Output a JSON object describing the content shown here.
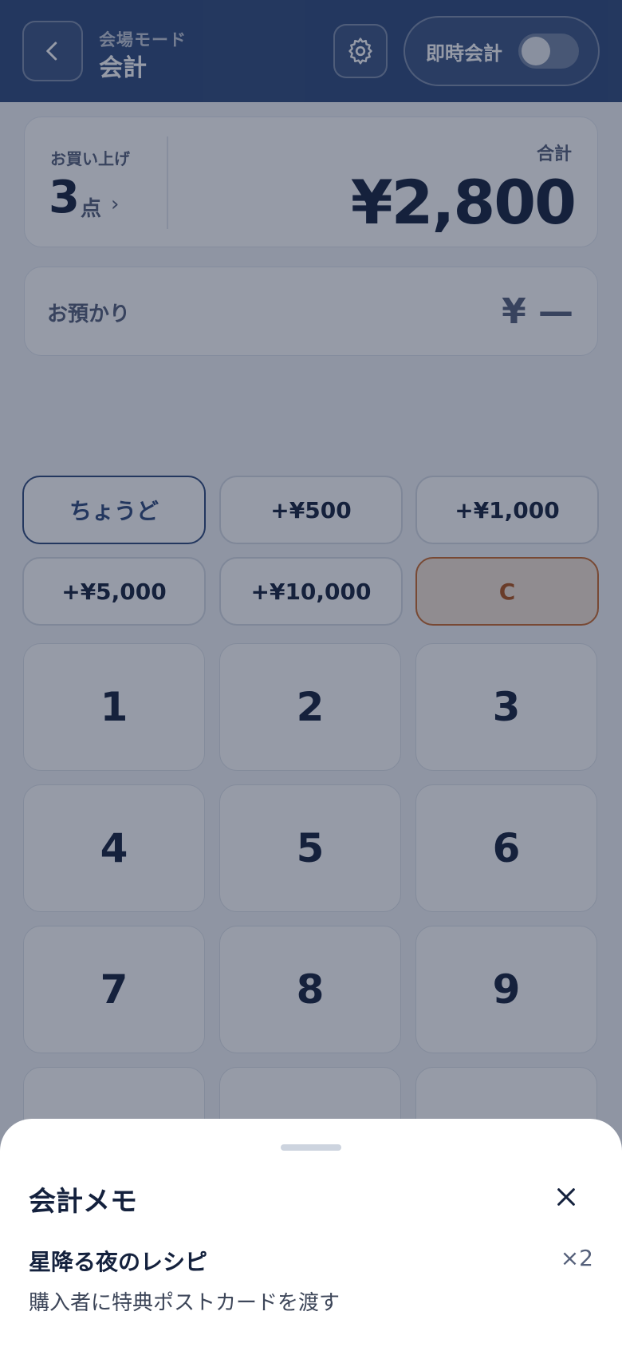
{
  "header": {
    "subtitle": "会場モード",
    "title": "会計",
    "instant_checkout_label": "即時会計",
    "instant_checkout_on": false,
    "back_icon": "chevron-left-icon",
    "settings_icon": "gear-icon"
  },
  "summary": {
    "items_label": "お買い上げ",
    "items_count": "3",
    "items_unit": "点",
    "items_chevron": "›",
    "total_label": "合計",
    "total_value": "¥2,800"
  },
  "received": {
    "label": "お預かり",
    "value": "¥ —"
  },
  "quick_buttons": [
    "ちょうど",
    "+¥500",
    "+¥1,000",
    "+¥5,000",
    "+¥10,000",
    "C"
  ],
  "keypad": [
    "1",
    "2",
    "3",
    "4",
    "5",
    "6",
    "7",
    "8",
    "9"
  ],
  "sheet": {
    "title": "会計メモ",
    "close_icon": "close-icon",
    "item_name": "星降る夜のレシピ",
    "item_qty": "×2",
    "item_note": "購入者に特典ポストカードを渡す"
  },
  "colors": {
    "header_bg": "#2f4a7c",
    "accent": "#2f4a7c",
    "clear_accent": "#c96a2e"
  }
}
